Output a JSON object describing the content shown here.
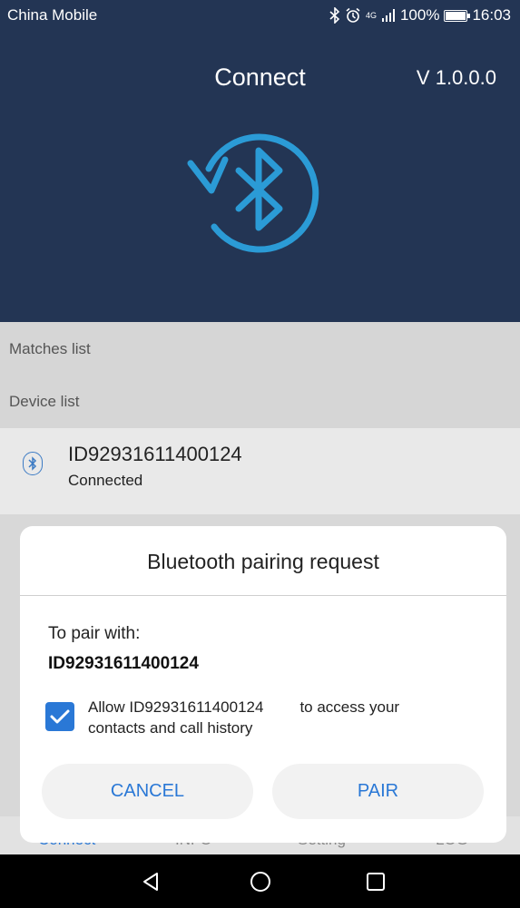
{
  "status_bar": {
    "carrier": "China Mobile",
    "network": "4G",
    "battery": "100%",
    "battery_level": 1.0,
    "time": "16:03"
  },
  "header": {
    "title": "Connect",
    "version": "V 1.0.0.0",
    "logo_icon": "bluetooth-refresh-icon"
  },
  "sections": {
    "matches_label": "Matches list",
    "devices_label": "Device list"
  },
  "device": {
    "name": "ID92931611400124",
    "status": "Connected",
    "icon": "bluetooth-icon"
  },
  "tabs": [
    "Connect",
    "INFO",
    "Setting",
    "LOG"
  ],
  "dialog": {
    "title": "Bluetooth pairing request",
    "prompt": "To pair with:",
    "device_id": "ID92931611400124",
    "allow_prefix": "Allow ID92931611400124",
    "allow_suffix": "to access your",
    "allow_line2": "contacts and call history",
    "checkbox_checked": true,
    "cancel_label": "CANCEL",
    "pair_label": "PAIR"
  },
  "colors": {
    "header_bg": "#233554",
    "accent": "#2a78d6",
    "logo": "#2b9bd6"
  }
}
